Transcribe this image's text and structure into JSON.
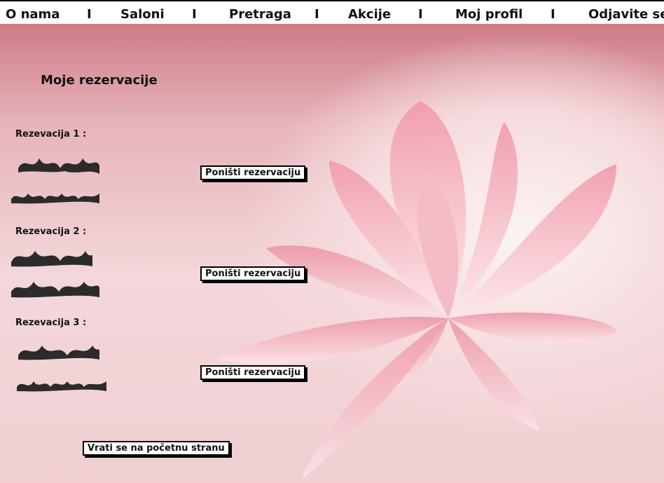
{
  "nav": {
    "items": [
      "O nama",
      "Saloni",
      "Pretraga",
      "Akcije",
      "Moj profil",
      "Odjavite se"
    ],
    "separator": "I"
  },
  "page": {
    "title": "Moje rezervacije",
    "reservations": [
      {
        "label": "Rezevacija 1 :",
        "cancel_label": "Poništi rezervaciju"
      },
      {
        "label": "Rezevacija 2 :",
        "cancel_label": "Poništi rezervaciju"
      },
      {
        "label": "Rezevacija 3 :",
        "cancel_label": "Poništi rezervaciju"
      }
    ],
    "back_label": "Vrati se na početnu stranu"
  },
  "colors": {
    "background_top": "#cf7c86",
    "petal": "#f2a9b6",
    "scribble": "#2b2b2b"
  }
}
